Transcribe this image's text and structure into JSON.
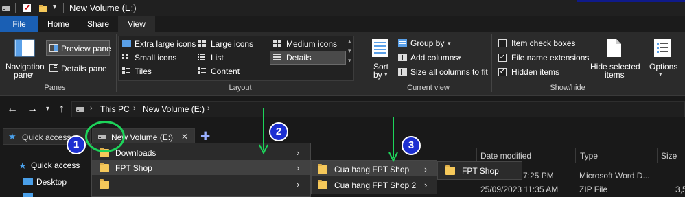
{
  "window": {
    "title": "New Volume (E:)"
  },
  "ribbon_tabs": [
    "File",
    "Home",
    "Share",
    "View"
  ],
  "panes": {
    "navigation_pane": "Navigation",
    "navigation_pane_2": "pane",
    "preview_pane": "Preview pane",
    "details_pane": "Details pane",
    "label": "Panes"
  },
  "layout": {
    "extra_large_icons": "Extra large icons",
    "large_icons": "Large icons",
    "medium_icons": "Medium icons",
    "small_icons": "Small icons",
    "list": "List",
    "details": "Details",
    "tiles": "Tiles",
    "content": "Content",
    "label": "Layout"
  },
  "current_view": {
    "sort_by": "Sort",
    "sort_by_2": "by",
    "group_by": "Group by",
    "add_columns": "Add columns",
    "size_all_columns": "Size all columns to fit",
    "label": "Current view"
  },
  "show_hide": {
    "item_check_boxes": "Item check boxes",
    "file_name_extensions": "File name extensions",
    "hidden_items": "Hidden items",
    "hide_selected": "Hide selected",
    "hide_selected_2": "items",
    "label": "Show/hide"
  },
  "options": {
    "label": "Options"
  },
  "address": {
    "this_pc": "This PC",
    "drive": "New Volume (E:)"
  },
  "file_tabs": {
    "quick_access": "Quick access",
    "current": "New Volume (E:)"
  },
  "nav_pane": {
    "quick_access": "Quick access",
    "desktop": "Desktop"
  },
  "columns": {
    "date_modified": "Date modified",
    "type": "Type",
    "size": "Size"
  },
  "rows": [
    {
      "date": "7:25 PM",
      "type": "Microsoft Word D...",
      "size": ""
    },
    {
      "date": "25/09/2023 11:35 AM",
      "type": "ZIP File",
      "size": "3,5"
    }
  ],
  "menu1": {
    "items": [
      "Downloads",
      "FPT Shop",
      ""
    ]
  },
  "menu2": {
    "items": [
      "Cua hang FPT Shop",
      "Cua hang FPT Shop 2"
    ]
  },
  "menu3": {
    "items": [
      "FPT Shop"
    ]
  },
  "badges": [
    "1",
    "2",
    "3"
  ],
  "colors": {
    "accent": "#1a5fb4",
    "badge": "#1c2fd1",
    "annotation": "#1dd45a",
    "folder": "#f5c85a"
  }
}
